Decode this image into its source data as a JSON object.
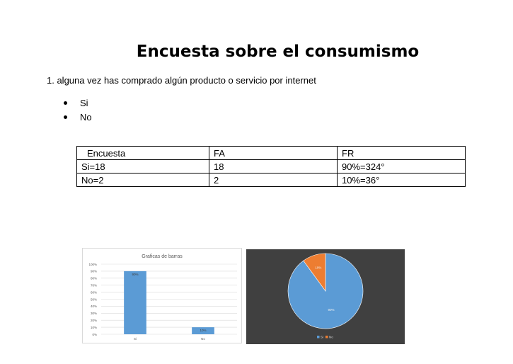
{
  "document": {
    "title": "Encuesta sobre el consumismo",
    "question": "1. alguna vez has comprado algún producto o servicio por internet",
    "options": [
      "Si",
      "No"
    ]
  },
  "table": {
    "headers": [
      "Encuesta",
      "FA",
      "FR"
    ],
    "rows": [
      [
        "Si=18",
        "18",
        "90%=324°"
      ],
      [
        "No=2",
        "2",
        "10%=36°"
      ]
    ]
  },
  "colors": {
    "bar": "#5b9bd5",
    "pie_si": "#5b9bd5",
    "pie_no": "#ed7d31",
    "pie_background": "#404040"
  },
  "chart_data": [
    {
      "type": "bar",
      "title": "Graficas de barras",
      "categories": [
        "Si",
        "No"
      ],
      "values": [
        90,
        10
      ],
      "data_labels": [
        "90%",
        "10%"
      ],
      "y_ticks": [
        "0%",
        "10%",
        "20%",
        "30%",
        "40%",
        "50%",
        "60%",
        "70%",
        "80%",
        "90%",
        "100%"
      ],
      "ylim": [
        0,
        100
      ],
      "grid": true,
      "legend": "none"
    },
    {
      "type": "pie",
      "categories": [
        "Si",
        "No"
      ],
      "values": [
        90,
        10
      ],
      "data_labels": [
        "90%",
        "10%"
      ],
      "legend": "bottom",
      "legend_labels": [
        "Si",
        "No"
      ]
    }
  ]
}
